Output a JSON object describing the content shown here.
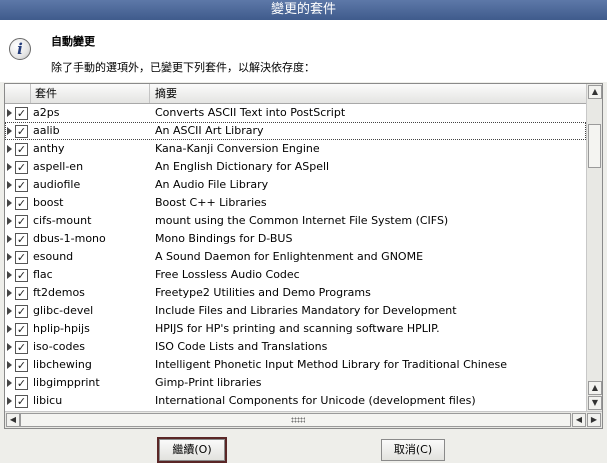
{
  "window": {
    "title": "變更的套件"
  },
  "header": {
    "icon": "info-icon",
    "title": "自動變更",
    "description": "除了手動的選項外，已變更下列套件，以解決依存度："
  },
  "table": {
    "columns": [
      "套件",
      "摘要"
    ],
    "rows": [
      {
        "name": "a2ps",
        "summary": "Converts ASCII Text into PostScript",
        "checked": true
      },
      {
        "name": "aalib",
        "summary": "An ASCII Art Library",
        "checked": true,
        "selected": true
      },
      {
        "name": "anthy",
        "summary": "Kana-Kanji Conversion Engine",
        "checked": true
      },
      {
        "name": "aspell-en",
        "summary": "An English Dictionary for ASpell",
        "checked": true
      },
      {
        "name": "audiofile",
        "summary": "An Audio File Library",
        "checked": true
      },
      {
        "name": "boost",
        "summary": "Boost C++ Libraries",
        "checked": true
      },
      {
        "name": "cifs-mount",
        "summary": "mount using the Common Internet File System (CIFS)",
        "checked": true
      },
      {
        "name": "dbus-1-mono",
        "summary": "Mono Bindings for D-BUS",
        "checked": true
      },
      {
        "name": "esound",
        "summary": "A Sound Daemon for Enlightenment and GNOME",
        "checked": true
      },
      {
        "name": "flac",
        "summary": "Free Lossless Audio Codec",
        "checked": true
      },
      {
        "name": "ft2demos",
        "summary": "Freetype2 Utilities and Demo Programs",
        "checked": true
      },
      {
        "name": "glibc-devel",
        "summary": "Include Files and Libraries Mandatory for Development",
        "checked": true
      },
      {
        "name": "hplip-hpijs",
        "summary": "HPIJS for HP's printing and scanning software HPLIP.",
        "checked": true
      },
      {
        "name": "iso-codes",
        "summary": "ISO Code Lists and Translations",
        "checked": true
      },
      {
        "name": "libchewing",
        "summary": "Intelligent Phonetic Input Method Library for Traditional Chinese",
        "checked": true
      },
      {
        "name": "libgimpprint",
        "summary": "Gimp-Print libraries",
        "checked": true
      },
      {
        "name": "libicu",
        "summary": "International Components for Unicode (development files)",
        "checked": true
      }
    ]
  },
  "buttons": {
    "continue_label": "繼續(O)",
    "cancel_label": "取消(C)"
  }
}
